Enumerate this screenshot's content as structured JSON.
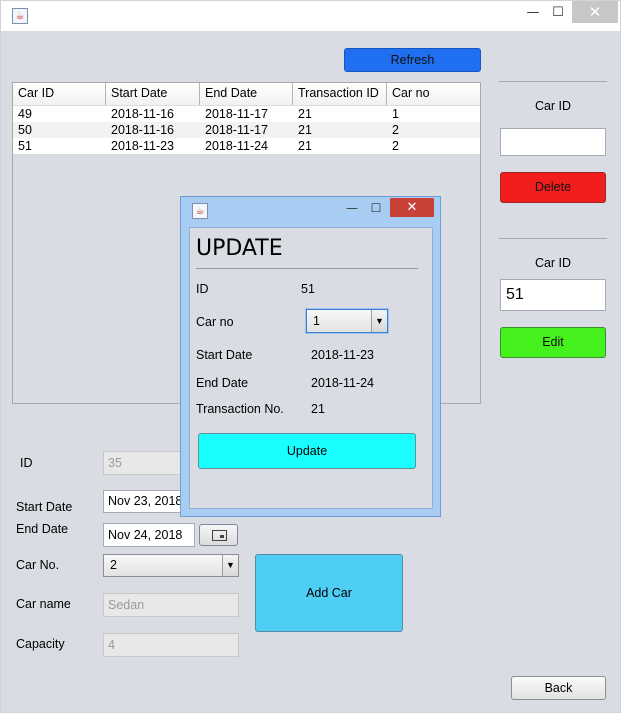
{
  "window": {
    "icon": "java-cup-icon",
    "minimize": "—",
    "maximize": "☐",
    "close": "✕"
  },
  "toolbar": {
    "refresh_label": "Refresh"
  },
  "table": {
    "columns": [
      "Car ID",
      "Start Date",
      "End Date",
      "Transaction ID",
      "Car no"
    ],
    "rows": [
      [
        "49",
        "2018-11-16",
        "2018-11-17",
        "21",
        "1"
      ],
      [
        "50",
        "2018-11-16",
        "2018-11-17",
        "21",
        "2"
      ],
      [
        "51",
        "2018-11-23",
        "2018-11-24",
        "21",
        "2"
      ]
    ]
  },
  "delete_panel": {
    "label": "Car ID",
    "value": "",
    "button": "Delete"
  },
  "edit_panel": {
    "label": "Car ID",
    "value": "51",
    "button": "Edit"
  },
  "form": {
    "id_label": "ID",
    "id_value": "35",
    "start_label": "Start Date",
    "start_value": "Nov 23, 2018",
    "end_label": "End Date",
    "end_value": "Nov 24, 2018",
    "carno_label": "Car No.",
    "carno_value": "2",
    "carname_label": "Car name",
    "carname_value": "Sedan",
    "capacity_label": "Capacity",
    "capacity_value": "4",
    "add_button": "Add Car",
    "back_button": "Back"
  },
  "dialog": {
    "title": "UPDATE",
    "id_label": "ID",
    "id_value": "51",
    "carno_label": "Car no",
    "carno_value": "1",
    "start_label": "Start Date",
    "start_value": "2018-11-23",
    "end_label": "End Date",
    "end_value": "2018-11-24",
    "txn_label": "Transaction No.",
    "txn_value": "21",
    "update_button": "Update"
  },
  "colors": {
    "refresh": "#1f6ff0",
    "delete": "#f21d1d",
    "edit": "#46f21d",
    "update": "#19ffff",
    "add_car": "#4ecdf5"
  }
}
